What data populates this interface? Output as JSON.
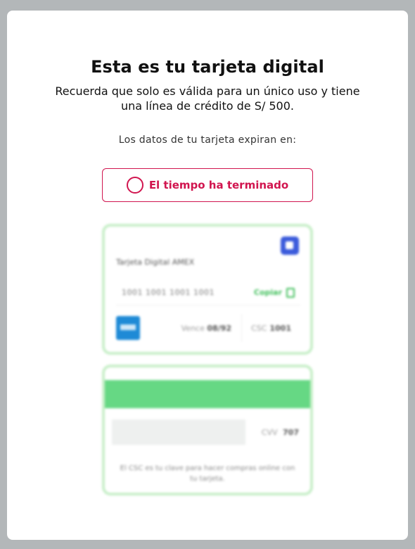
{
  "modal": {
    "title": "Esta es tu tarjeta digital",
    "subtitle": "Recuerda que solo es válida para un único uso y tiene una línea de crédito de S/ 500.",
    "expire_label": "Los datos de tu tarjeta expiran en:",
    "timer_text": "El tiempo ha terminado"
  },
  "card": {
    "name": "Tarjeta Digital AMEX",
    "number": "1001 1001 1001 1001",
    "copy_label": "Copiar",
    "vence_label": "Vence",
    "vence_value": "08/92",
    "csc_label": "CSC",
    "csc_value": "1001"
  },
  "card_back": {
    "cvv_label": "CVV",
    "cvv_value": "707",
    "note": "El CSC es tu clave para hacer compras online con tu tarjeta."
  },
  "colors": {
    "accent": "#d1154f",
    "card_border": "#c8efc9",
    "stripe": "#66d884",
    "amex_blue": "#1e8ad6",
    "backdrop": "#b3b7b9"
  }
}
